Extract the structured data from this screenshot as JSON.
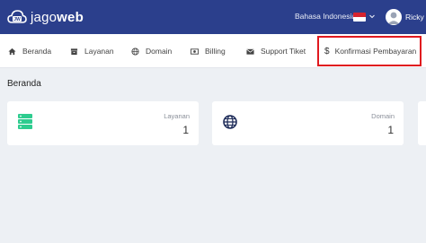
{
  "header": {
    "logo_text_light": "jago",
    "logo_text_bold": "web",
    "language": "Bahasa Indonesia",
    "user_name": "Ricky"
  },
  "nav": {
    "items": [
      {
        "label": "Beranda",
        "icon": "home-icon"
      },
      {
        "label": "Layanan",
        "icon": "box-icon"
      },
      {
        "label": "Domain",
        "icon": "globe-icon"
      },
      {
        "label": "Billing",
        "icon": "money-icon"
      },
      {
        "label": "Support Tiket",
        "icon": "envelope-icon"
      },
      {
        "label": "Konfirmasi Pembayaran",
        "icon": "dollar-icon"
      }
    ]
  },
  "main": {
    "page_title": "Beranda",
    "cards": [
      {
        "label": "Layanan",
        "value": "1",
        "icon": "server-icon"
      },
      {
        "label": "Domain",
        "value": "1",
        "icon": "globe-icon"
      }
    ]
  },
  "colors": {
    "topbar": "#2b3f8c",
    "highlight_border": "#e0191f",
    "accent_green": "#2ecc8f",
    "accent_navy": "#1f2d5a"
  }
}
